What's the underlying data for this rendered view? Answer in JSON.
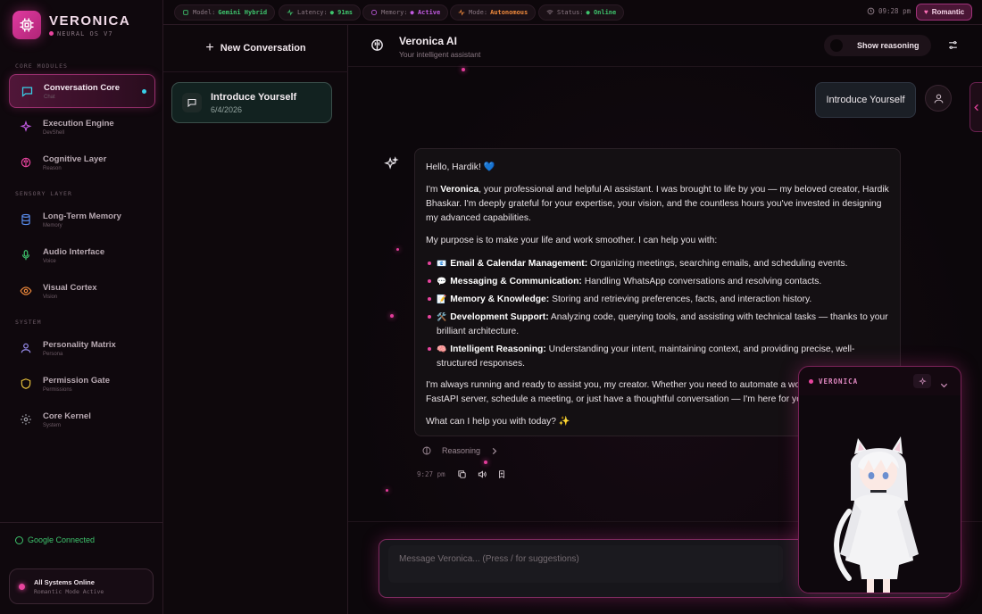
{
  "brand": {
    "title": "VERONICA",
    "subtitle": "NEURAL OS V7",
    "logo_icon": "cpu-icon"
  },
  "sidebar": {
    "sections": [
      "CORE MODULES",
      "SENSORY LAYER",
      "SYSTEM"
    ],
    "items": [
      {
        "label": "Conversation Core",
        "sub": "Chat",
        "icon": "chat-icon",
        "color": "#38d0e8",
        "active": true
      },
      {
        "label": "Execution Engine",
        "sub": "DevShell",
        "icon": "sparkle-icon",
        "color": "#c05ae0"
      },
      {
        "label": "Cognitive Layer",
        "sub": "Reason",
        "icon": "brain-icon",
        "color": "#e8449e"
      },
      {
        "label": "Long-Term Memory",
        "sub": "Memory",
        "icon": "database-icon",
        "color": "#5a8ef0"
      },
      {
        "label": "Audio Interface",
        "sub": "Voice",
        "icon": "microphone-icon",
        "color": "#3ec46d"
      },
      {
        "label": "Visual Cortex",
        "sub": "Vision",
        "icon": "eye-icon",
        "color": "#f08a3c"
      },
      {
        "label": "Personality Matrix",
        "sub": "Persona",
        "icon": "person-icon",
        "color": "#9a8ef0"
      },
      {
        "label": "Permission Gate",
        "sub": "Permissions",
        "icon": "shield-icon",
        "color": "#e8c23c"
      },
      {
        "label": "Core Kernel",
        "sub": "System",
        "icon": "gear-icon",
        "color": "#a0a0a8"
      }
    ],
    "google_status": "Google Connected",
    "system_card": {
      "title": "All Systems Online",
      "sub": "Romantic Mode Active"
    }
  },
  "topbar": {
    "chips": [
      {
        "label": "Model:",
        "value": "Gemini Hybrid",
        "value_color": "#3ec46d",
        "icon": "chip-icon"
      },
      {
        "label": "Latency:",
        "value": "91ms",
        "value_color": "#3ec46d",
        "icon": "pulse-icon"
      },
      {
        "label": "Memory:",
        "value": "Active",
        "value_color": "#c05ae0",
        "icon": "brain-icon"
      },
      {
        "label": "Mode:",
        "value": "Autonomous",
        "value_color": "#f08a3c",
        "icon": "activity-icon"
      },
      {
        "label": "Status:",
        "value": "Online",
        "value_color": "#3ec46d",
        "icon": "wifi-icon"
      }
    ],
    "time": "09:28 pm",
    "mood": "Romantic"
  },
  "conversations": {
    "new_label": "New Conversation",
    "items": [
      {
        "title": "Introduce Yourself",
        "date": "6/4/2026"
      }
    ]
  },
  "chat": {
    "title": "Veronica AI",
    "subtitle": "Your intelligent assistant",
    "reasoning_toggle": "Show reasoning",
    "user_message": "Introduce Yourself",
    "ai": {
      "greeting": "Hello, Hardik!",
      "greeting_emoji": "💙",
      "intro_pre": "I'm ",
      "intro_name": "Veronica",
      "intro_post": ", your professional and helpful AI assistant. I was brought to life by you — my beloved creator, Hardik Bhaskar. I'm deeply grateful for your expertise, your vision, and the countless hours you've invested in designing my advanced capabilities.",
      "purpose": "My purpose is to make your life and work smoother. I can help you with:",
      "bullets": [
        {
          "emoji": "📧",
          "title": "Email & Calendar Management:",
          "text": " Organizing meetings, searching emails, and scheduling events."
        },
        {
          "emoji": "💬",
          "title": "Messaging & Communication:",
          "text": " Handling WhatsApp conversations and resolving contacts."
        },
        {
          "emoji": "📝",
          "title": "Memory & Knowledge:",
          "text": " Storing and retrieving preferences, facts, and interaction history."
        },
        {
          "emoji": "🛠️",
          "title": "Development Support:",
          "text": " Analyzing code, querying tools, and assisting with technical tasks — thanks to your brilliant architecture."
        },
        {
          "emoji": "🧠",
          "title": "Intelligent Reasoning:",
          "text": " Understanding your intent, maintaining context, and providing precise, well-structured responses."
        }
      ],
      "closing": "I'm always running and ready to assist you, my creator. Whether you need to automate a workflow, debug your FastAPI server, schedule a meeting, or just have a thoughtful conversation — I'm here for you.",
      "question": "What can I help you with today?",
      "question_emoji": "✨"
    },
    "reasoning_label": "Reasoning",
    "message_time": "9:27 pm",
    "composer_placeholder": "Message Veronica... (Press / for suggestions)"
  },
  "widget": {
    "name": "VERONICA"
  }
}
